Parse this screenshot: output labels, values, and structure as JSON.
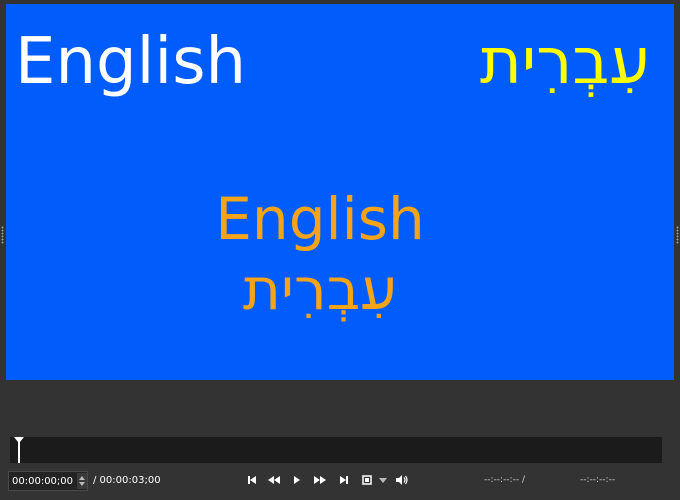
{
  "preview": {
    "background": "#005cfb",
    "top_left_text": "English",
    "top_right_text": "עִבְרִית",
    "center_text_line1": "English",
    "center_text_line2": "עִבְרִית",
    "colors": {
      "white": "#ffffff",
      "yellow": "#ffff00",
      "orange": "#f5a41a"
    }
  },
  "transport": {
    "position": "00:00:00;00",
    "duration": "/ 00:00:03;00",
    "in_point": "--:--:--:-- /",
    "out_point": "--:--:--:--"
  },
  "icons": [
    "playhead-icon",
    "spinner-up-icon",
    "spinner-down-icon",
    "skip-to-start-icon",
    "rewind-icon",
    "play-icon",
    "fast-forward-icon",
    "skip-to-end-icon",
    "zoom-fit-icon",
    "zoom-dropdown-icon",
    "volume-icon"
  ]
}
